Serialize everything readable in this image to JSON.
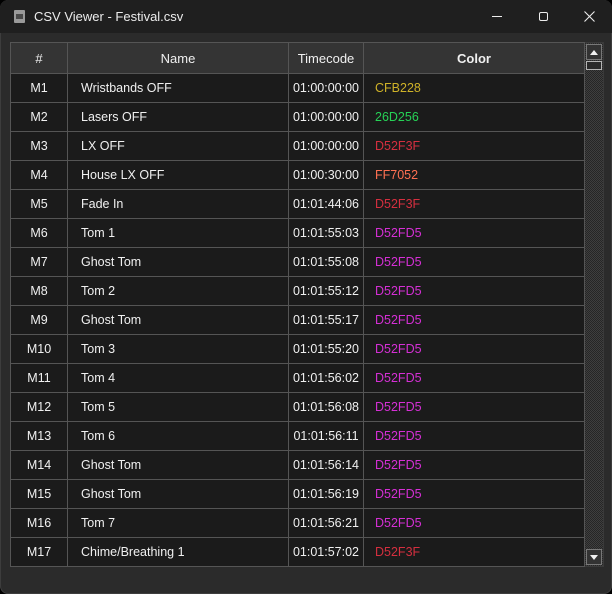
{
  "window": {
    "title": "CSV Viewer - Festival.csv",
    "icons": {
      "app": "document-icon",
      "minimize": "minimize-icon",
      "maximize": "maximize-icon",
      "close": "close-icon",
      "scroll_up": "scroll-up-arrow-icon",
      "scroll_down": "scroll-down-arrow-icon"
    },
    "close_glyph": "✕"
  },
  "theme": {
    "titlebar_bg": "#1f1f1f",
    "client_bg": "#2b2b2b",
    "header_bg": "#343434",
    "cell_bg": "#1b1b1b",
    "grid_border": "#555555",
    "text": "#f0f0f0"
  },
  "table": {
    "columns": [
      "#",
      "Name",
      "Timecode",
      "Color"
    ],
    "rows": [
      {
        "id": "M1",
        "name": "Wristbands OFF",
        "timecode": "01:00:00:00",
        "color": "CFB228"
      },
      {
        "id": "M2",
        "name": "Lasers OFF",
        "timecode": "01:00:00:00",
        "color": "26D256"
      },
      {
        "id": "M3",
        "name": "LX OFF",
        "timecode": "01:00:00:00",
        "color": "D52F3F"
      },
      {
        "id": "M4",
        "name": "House LX OFF",
        "timecode": "01:00:30:00",
        "color": "FF7052"
      },
      {
        "id": "M5",
        "name": "Fade In",
        "timecode": "01:01:44:06",
        "color": "D52F3F"
      },
      {
        "id": "M6",
        "name": "Tom 1",
        "timecode": "01:01:55:03",
        "color": "D52FD5"
      },
      {
        "id": "M7",
        "name": "Ghost Tom",
        "timecode": "01:01:55:08",
        "color": "D52FD5"
      },
      {
        "id": "M8",
        "name": "Tom 2",
        "timecode": "01:01:55:12",
        "color": "D52FD5"
      },
      {
        "id": "M9",
        "name": "Ghost Tom",
        "timecode": "01:01:55:17",
        "color": "D52FD5"
      },
      {
        "id": "M10",
        "name": "Tom 3",
        "timecode": "01:01:55:20",
        "color": "D52FD5"
      },
      {
        "id": "M11",
        "name": "Tom 4",
        "timecode": "01:01:56:02",
        "color": "D52FD5"
      },
      {
        "id": "M12",
        "name": "Tom 5",
        "timecode": "01:01:56:08",
        "color": "D52FD5"
      },
      {
        "id": "M13",
        "name": "Tom 6",
        "timecode": "01:01:56:11",
        "color": "D52FD5"
      },
      {
        "id": "M14",
        "name": "Ghost Tom",
        "timecode": "01:01:56:14",
        "color": "D52FD5"
      },
      {
        "id": "M15",
        "name": "Ghost Tom",
        "timecode": "01:01:56:19",
        "color": "D52FD5"
      },
      {
        "id": "M16",
        "name": "Tom 7",
        "timecode": "01:01:56:21",
        "color": "D52FD5"
      },
      {
        "id": "M17",
        "name": "Chime/Breathing 1",
        "timecode": "01:01:57:02",
        "color": "D52F3F"
      }
    ]
  }
}
